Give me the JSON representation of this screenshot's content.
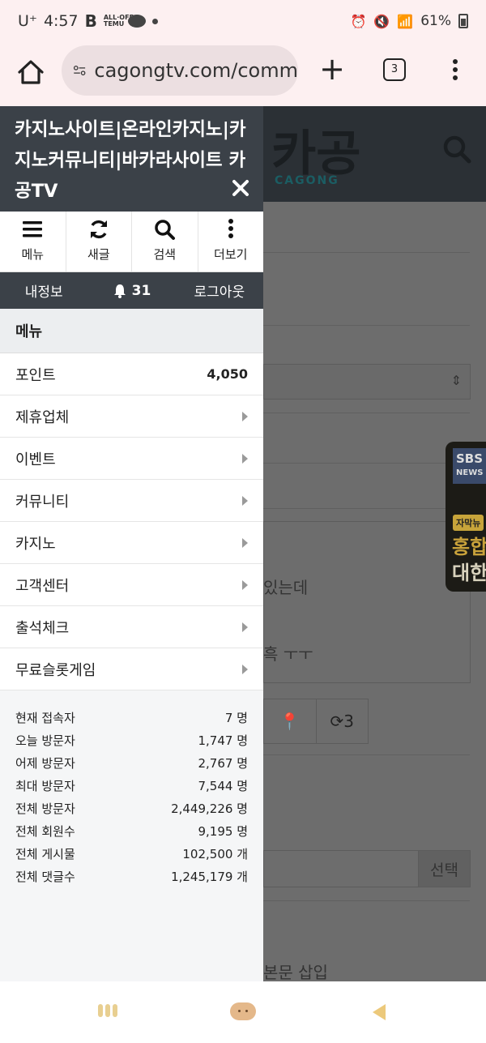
{
  "status_bar": {
    "carrier": "U⁺",
    "time": "4:57",
    "app_b": "B",
    "app_temu": "ALL·OFF TEMU",
    "battery": "61%"
  },
  "browser": {
    "url": "cagongtv.com/comm",
    "tab_count": "3"
  },
  "background_page": {
    "logo": "카공",
    "logo_sub": "CAGONG",
    "text_line1": "있는데",
    "text_line2": "흑 ㅜㅜ",
    "refresh_count": "3",
    "select_button": "선택",
    "insert_label": "본문 삽입",
    "ad": {
      "brand": "SBS",
      "brand_sub": "NEWS",
      "tag": "자막뉴",
      "line1": "홍합",
      "line2": "대한"
    }
  },
  "drawer": {
    "title": "카지노사이트|온라인카지노|카지노커뮤니티|바카라사이트 카공TV",
    "icons": [
      {
        "label": "메뉴",
        "icon": "hamburger-icon"
      },
      {
        "label": "새글",
        "icon": "refresh-icon"
      },
      {
        "label": "검색",
        "icon": "search-icon"
      },
      {
        "label": "더보기",
        "icon": "more-vertical-icon"
      }
    ],
    "user": {
      "my_info": "내정보",
      "notifications": "31",
      "logout": "로그아웃"
    },
    "menu_header": "메뉴",
    "menu": [
      {
        "label": "포인트",
        "value": "4,050"
      },
      {
        "label": "제휴업체"
      },
      {
        "label": "이벤트"
      },
      {
        "label": "커뮤니티"
      },
      {
        "label": "카지노"
      },
      {
        "label": "고객센터"
      },
      {
        "label": "출석체크"
      },
      {
        "label": "무료슬롯게임"
      }
    ],
    "stats": [
      {
        "label": "현재 접속자",
        "value": "7 명"
      },
      {
        "label": "오늘 방문자",
        "value": "1,747 명"
      },
      {
        "label": "어제 방문자",
        "value": "2,767 명"
      },
      {
        "label": "최대 방문자",
        "value": "7,544 명"
      },
      {
        "label": "전체 방문자",
        "value": "2,449,226 명"
      },
      {
        "label": "전체 회원수",
        "value": "9,195 명"
      },
      {
        "label": "전체 게시물",
        "value": "102,500 개"
      },
      {
        "label": "전체 댓글수",
        "value": "1,245,179 개"
      }
    ]
  }
}
